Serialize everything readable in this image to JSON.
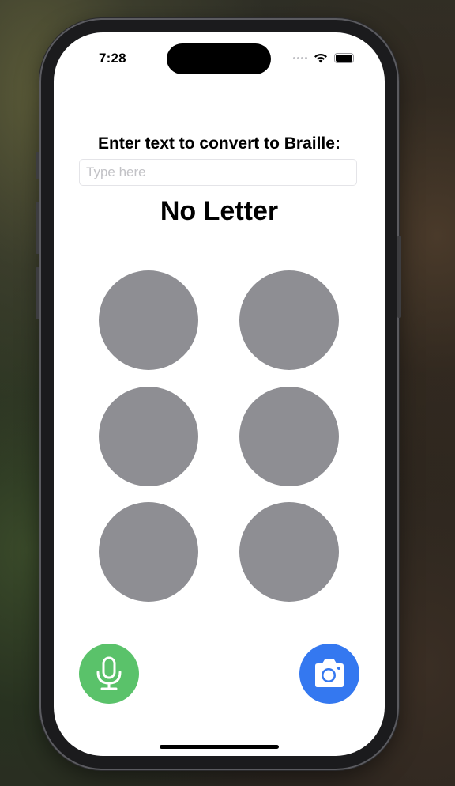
{
  "status_bar": {
    "time": "7:28",
    "icons": [
      "cellular-signal-icon",
      "wifi-icon",
      "battery-icon"
    ]
  },
  "main": {
    "prompt": "Enter text to convert to Braille:",
    "input": {
      "placeholder": "Type here",
      "value": ""
    },
    "letter": "No Letter",
    "braille_cell": {
      "dots": [
        {
          "number": 1,
          "raised": false
        },
        {
          "number": 2,
          "raised": false
        },
        {
          "number": 3,
          "raised": false
        },
        {
          "number": 4,
          "raised": false
        },
        {
          "number": 5,
          "raised": false
        },
        {
          "number": 6,
          "raised": false
        }
      ],
      "inactive_color": "#8e8e93"
    }
  },
  "actions": {
    "microphone": {
      "icon": "microphone-icon",
      "color": "#5ac26a"
    },
    "camera": {
      "icon": "camera-icon",
      "color": "#3478f0"
    }
  }
}
